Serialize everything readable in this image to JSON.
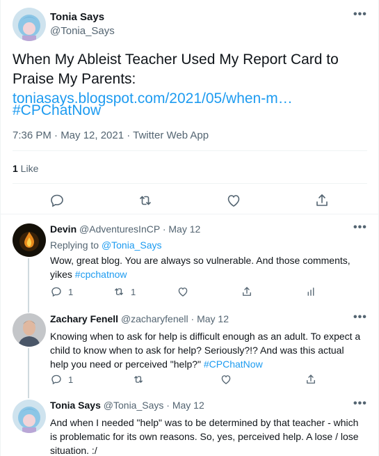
{
  "main_tweet": {
    "author_name": "Tonia Says",
    "author_handle": "@Tonia_Says",
    "text_before_link": "When My Ableist Teacher Used My Report Card to Praise My Parents: ",
    "link_text": "toniasays.blogspot.com/2021/05/when-m…",
    "hashtag": "#CPChatNow",
    "meta": "7:36 PM · May 12, 2021 · Twitter Web App",
    "likes_count": "1",
    "likes_label": " Like"
  },
  "replies": [
    {
      "author_name": "Devin",
      "author_handle": "@AdventuresInCP",
      "time": "· May 12",
      "replying_prefix": "Replying to ",
      "replying_handle": "@Tonia_Says",
      "text": "Wow, great blog. You are always so vulnerable. And those comments, yikes ",
      "hashtag": "#cpchatnow",
      "reply_count": "1",
      "retweet_count": "1"
    },
    {
      "author_name": "Zachary Fenell",
      "author_handle": "@zacharyfenell",
      "time": "· May 12",
      "text": "Knowing when to ask for help is difficult enough as an adult. To expect a child to know when to ask for help? Seriously?!? And was this actual help you need or perceived \"help?\" ",
      "hashtag": "#CPChatNow",
      "reply_count": "1"
    },
    {
      "author_name": "Tonia Says",
      "author_handle": "@Tonia_Says",
      "time": "· May 12",
      "text": "And when I needed \"help\" was to be determined by that teacher - which is problematic for its own reasons. So, yes, perceived help.  A lose / lose situation. :/"
    }
  ],
  "icons": {
    "more": "•••",
    "reply": "reply-icon",
    "retweet": "retweet-icon",
    "like": "heart-icon",
    "share": "share-icon",
    "analytics": "analytics-icon"
  },
  "colors": {
    "link": "#1d9bf0",
    "secondary_text": "#536471",
    "border": "#eff3f4"
  }
}
